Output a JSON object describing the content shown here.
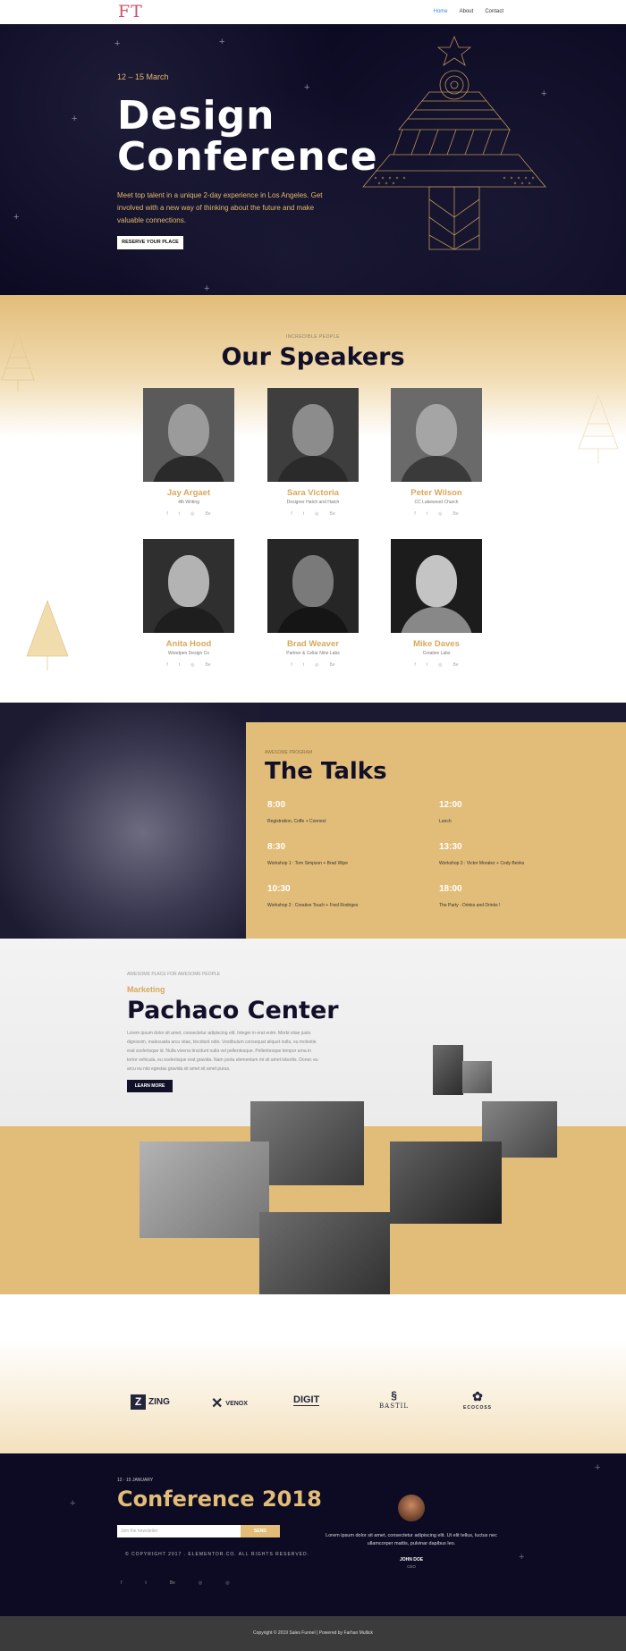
{
  "nav": {
    "logo": "FT",
    "items": [
      {
        "label": "Home",
        "active": true
      },
      {
        "label": "About",
        "active": false
      },
      {
        "label": "Contact",
        "active": false
      }
    ]
  },
  "hero": {
    "date": "12 – 15  March",
    "title_line1": "Design",
    "title_line2": "Conference",
    "description": "Meet top talent in a unique 2-day experience in Los Angeles. Get involved with a new way of thinking about the future and make valuable connections.",
    "button": "RESERVE YOUR PLACE"
  },
  "speakers": {
    "eyebrow": "INCREDIBLE PEOPLE",
    "title": "Our Speakers",
    "list": [
      {
        "name": "Jay Argaet",
        "role": "4th Writing"
      },
      {
        "name": "Sara Victoria",
        "role": "Designer Hatch and Hatch"
      },
      {
        "name": "Peter Wilson",
        "role": "CC Lakewood Church"
      },
      {
        "name": "Anita Hood",
        "role": "Woodpen Design Co"
      },
      {
        "name": "Brad Weaver",
        "role": "Partner & Cellar Nine Labs"
      },
      {
        "name": "Mike Daves",
        "role": "Creative Labs"
      }
    ],
    "social_icons": [
      "f",
      "t",
      "◎",
      "Be"
    ]
  },
  "talks": {
    "eyebrow": "AWESOME PROGRAM",
    "title": "The Talks",
    "slots": [
      {
        "time": "8:00",
        "what": "Registration, Coffe + Connect"
      },
      {
        "time": "12:00",
        "what": "Lunch"
      },
      {
        "time": "8:30",
        "what": "Workshop 1 : Tom Simpson + Brad Wipe"
      },
      {
        "time": "13:30",
        "what": "Workshop 3 : Victor Moralez + Cody Benks"
      },
      {
        "time": "10:30",
        "what": "Workshop 2 : Creative Touch + Fred Rodriges"
      },
      {
        "time": "18:00",
        "what": "The Party - Drinks and Drinks !"
      }
    ]
  },
  "venue": {
    "eyebrow": "AWESOME PLACE FOR AWESOME PEOPLE",
    "subtitle": "Marketing",
    "title": "Pachaco Center",
    "body": "Lorem ipsum dolor sit amet, consectetur adipiscing elit. Integer in erat enim. Morbi vitae justo dignissim, malesuada arcu vitae, tincidunt odio. Vestibulum consequat aliquet nulla, eu molestie erat scelerisque id. Nulla viverra tincidunt nulla vel pellentesque. Pellentesque tempor urna in tortor vehicula, eu scelerisque erat gravida. Nam porta elementum mi sit amet lobortis. Donec eu arcu eu nisi egestas gravida sit amet sit amet purus.",
    "button": "LEARN MORE"
  },
  "partners": [
    "ZING",
    "VENOX",
    "DIGIT",
    "BASTIL",
    "ECOCOSS"
  ],
  "footer": {
    "date": "12 - 15 JANUARY",
    "title": "Conference 2018",
    "newsletter_placeholder": "Join the newsletter",
    "newsletter_button": "SEND",
    "copyright": "© COPYRIGHT 2017 . ELEMENTOR.CO. ALL RIGHTS RESERVED.",
    "social_icons": [
      "f",
      "t",
      "Be",
      "◎",
      "◎"
    ],
    "quote": "Lorem ipsum dolor sit amet, consectetur adipiscing elit. Ut elit tellus, luctus nec ullamcorper mattis, pulvinar dapibus leo.",
    "author": "JOHN DOE",
    "author_role": "CEO"
  },
  "bottom_bar": "Copyright © 2019 Sales Funnel | Powered by Farhan Mullick",
  "colors": {
    "navy": "#0d0b24",
    "gold": "#e2bd79",
    "gold_text": "#d8a85b",
    "nav_active": "#3a8fd0",
    "logo": "#c9556b"
  }
}
